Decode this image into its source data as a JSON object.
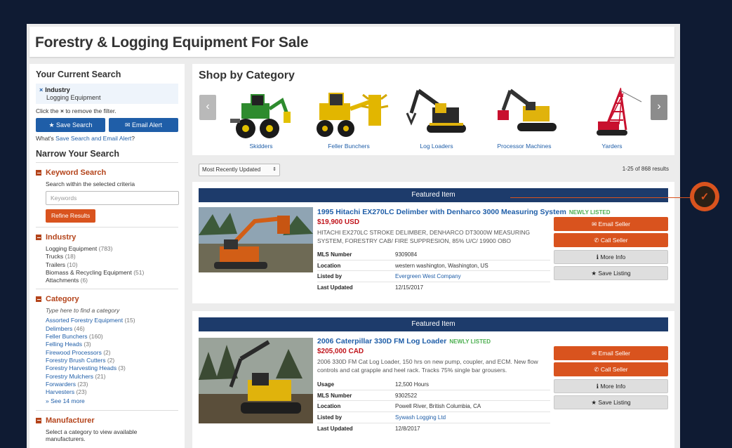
{
  "page_title": "Forestry & Logging Equipment For Sale",
  "sidebar": {
    "current_search_heading": "Your Current Search",
    "filter": {
      "remove_icon": "×",
      "name": "Industry",
      "value": "Logging Equipment"
    },
    "remove_hint_prefix": "Click the",
    "remove_hint_icon": "×",
    "remove_hint_suffix": "to remove the filter.",
    "save_search_label": "Save Search",
    "email_alert_label": "Email Alert",
    "whats_prefix": "What's",
    "whats_link": "Save Search and Email Alert",
    "whats_suffix": "?",
    "narrow_heading": "Narrow Your Search",
    "keyword": {
      "heading": "Keyword Search",
      "hint": "Search within the selected criteria",
      "placeholder": "Keywords",
      "button": "Refine Results"
    },
    "industry": {
      "heading": "Industry",
      "items": [
        {
          "label": "Logging Equipment",
          "count": "(783)"
        },
        {
          "label": "Trucks",
          "count": "(18)"
        },
        {
          "label": "Trailers",
          "count": "(10)"
        },
        {
          "label": "Biomass & Recycling Equipment",
          "count": "(51)"
        },
        {
          "label": "Attachments",
          "count": "(6)"
        }
      ]
    },
    "category": {
      "heading": "Category",
      "placeholder": "Type here to find a category",
      "items": [
        {
          "label": "Assorted Forestry Equipment",
          "count": "(15)"
        },
        {
          "label": "Delimbers",
          "count": "(46)"
        },
        {
          "label": "Feller Bunchers",
          "count": "(160)"
        },
        {
          "label": "Felling Heads",
          "count": "(3)"
        },
        {
          "label": "Firewood Processors",
          "count": "(2)"
        },
        {
          "label": "Forestry Brush Cutters",
          "count": "(2)"
        },
        {
          "label": "Forestry Harvesting Heads",
          "count": "(3)"
        },
        {
          "label": "Forestry Mulchers",
          "count": "(21)"
        },
        {
          "label": "Forwarders",
          "count": "(23)"
        },
        {
          "label": "Harvesters",
          "count": "(23)"
        }
      ],
      "see_more": "See 14 more"
    },
    "manufacturer": {
      "heading": "Manufacturer",
      "hint": "Select a category to view available manufacturers."
    }
  },
  "shop": {
    "heading": "Shop by Category",
    "prev_icon": "‹",
    "next_icon": "›",
    "categories": [
      {
        "label": "Skidders",
        "color": "#2e8b2e"
      },
      {
        "label": "Feller Bunchers",
        "color": "#e2b600"
      },
      {
        "label": "Log Loaders",
        "color": "#2a2a2a"
      },
      {
        "label": "Processor Machines",
        "color": "#e0b30c"
      },
      {
        "label": "Yarders",
        "color": "#c8102e"
      }
    ]
  },
  "sort": {
    "selected": "Most Recently Updated",
    "caret": "⇕"
  },
  "results_count": "1-25 of 868 results",
  "listings": [
    {
      "featured_label": "Featured Item",
      "title": "1995 Hitachi EX270LC Delimber with Denharco 3000 Measuring System",
      "badge": "NEWLY LISTED",
      "price": "$19,900 USD",
      "description": "HITACHI EX270LC STROKE DELIMBER, DENHARCO DT3000W MEASURING SYSTEM, FORESTRY CAB/ FIRE SUPPRESION, 85% U/C/ 19900 OBO",
      "specs": [
        {
          "key": "MLS Number",
          "value": "9309084",
          "link": false
        },
        {
          "key": "Location",
          "value": "western washington, Washington, US",
          "link": false
        },
        {
          "key": "Listed by",
          "value": "Evergreen West Company",
          "link": true
        },
        {
          "key": "Last Updated",
          "value": "12/15/2017",
          "link": false
        }
      ],
      "actions": {
        "email": "Email Seller",
        "call": "Call Seller",
        "info": "More Info",
        "save": "Save Listing"
      }
    },
    {
      "featured_label": "Featured Item",
      "title": "2006 Caterpillar 330D FM Log Loader",
      "badge": "NEWLY LISTED",
      "price": "$205,000 CAD",
      "description": "2006 330D FM Cat Log Loader, 150 hrs on new pump, coupler, and ECM. New flow controls and cat grapple and heel rack. Tracks 75% single bar grousers.",
      "specs": [
        {
          "key": "Usage",
          "value": "12,500 Hours",
          "link": false
        },
        {
          "key": "MLS Number",
          "value": "9302522",
          "link": false
        },
        {
          "key": "Location",
          "value": "Powell River, British Columbia, CA",
          "link": false
        },
        {
          "key": "Listed by",
          "value": "Sywash Logging Ltd",
          "link": true
        },
        {
          "key": "Last Updated",
          "value": "12/8/2017",
          "link": false
        }
      ],
      "actions": {
        "email": "Email Seller",
        "call": "Call Seller",
        "info": "More Info",
        "save": "Save Listing"
      }
    }
  ],
  "icons": {
    "star": "★",
    "envelope": "✉",
    "phone": "✆",
    "info": "ℹ",
    "check": "✓",
    "remove": "×",
    "chevron_down": "»"
  },
  "colors": {
    "accent_orange": "#d9531e",
    "link_blue": "#1f5ea8",
    "featured_navy": "#1d3b6b",
    "price_red": "#c0141b",
    "badge_green": "#4caf50",
    "background": "#0f1b33"
  }
}
